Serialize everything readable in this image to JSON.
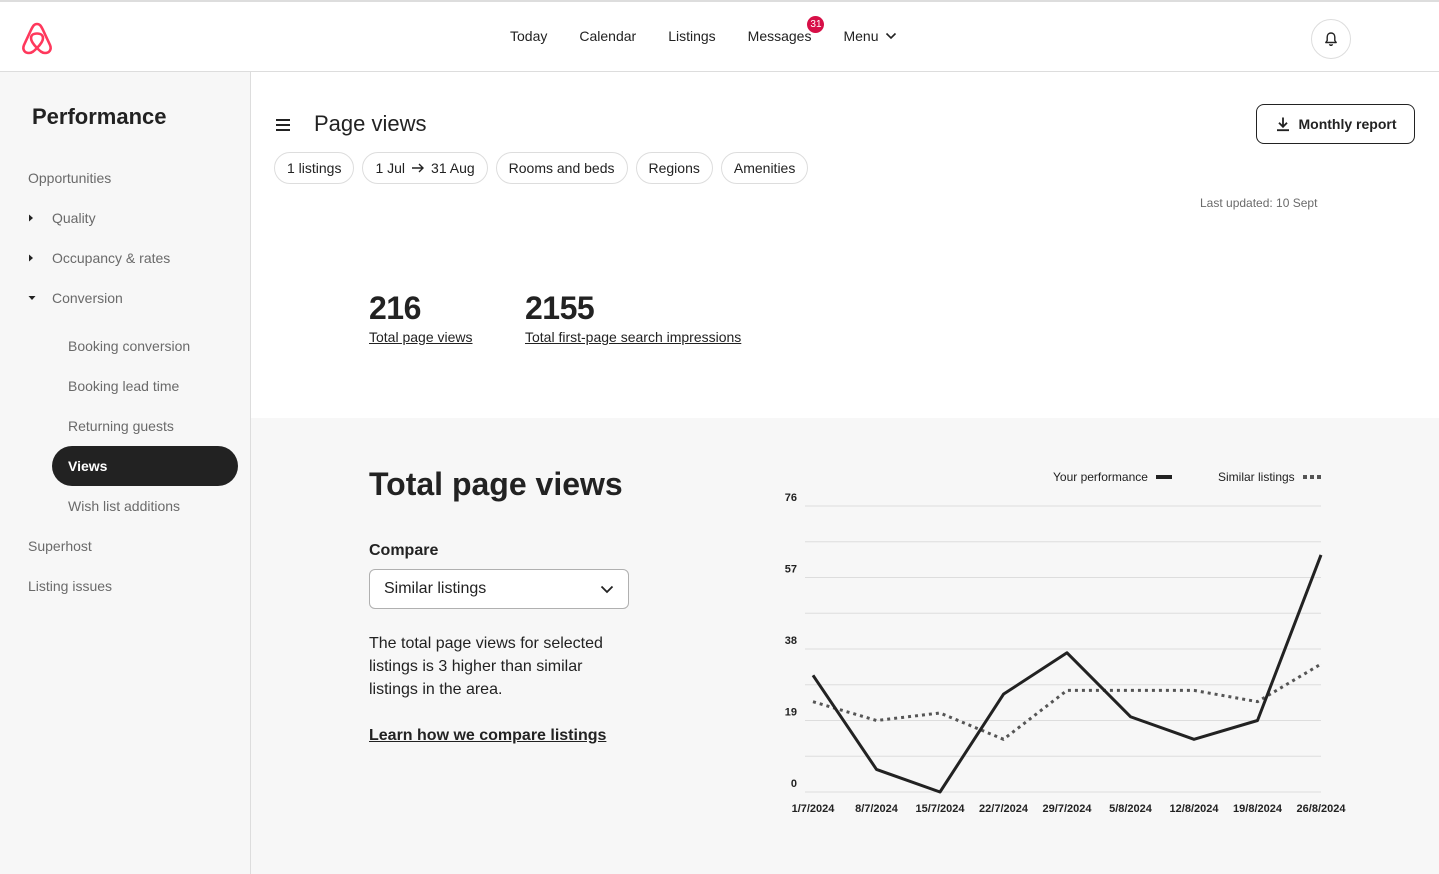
{
  "topnav": {
    "items": [
      "Today",
      "Calendar",
      "Listings",
      "Messages"
    ],
    "messages_badge": "31",
    "menu_label": "Menu"
  },
  "sidebar": {
    "title": "Performance",
    "items": [
      {
        "label": "Opportunities"
      },
      {
        "label": "Quality"
      },
      {
        "label": "Occupancy & rates"
      },
      {
        "label": "Conversion"
      },
      {
        "label": "Booking conversion"
      },
      {
        "label": "Booking lead time"
      },
      {
        "label": "Returning guests"
      },
      {
        "label": "Views"
      },
      {
        "label": "Wish list additions"
      },
      {
        "label": "Superhost"
      },
      {
        "label": "Listing issues"
      }
    ]
  },
  "header": {
    "title": "Page views",
    "monthly_report": "Monthly report",
    "filters": {
      "listings": "1 listings",
      "date_from": "1 Jul",
      "date_to": "31 Aug",
      "rooms": "Rooms and beds",
      "regions": "Regions",
      "amenities": "Amenities"
    },
    "last_updated": "Last updated: 10 Sept"
  },
  "stats": [
    {
      "value": "216",
      "label": "Total page views"
    },
    {
      "value": "2155",
      "label": "Total first-page search impressions"
    }
  ],
  "panel": {
    "title": "Total page views",
    "compare_label": "Compare",
    "compare_value": "Similar listings",
    "description": "The total page views for selected listings is 3 higher than similar listings in the area.",
    "learn_link": "Learn how we compare listings"
  },
  "colors": {
    "brand": "#ff385c",
    "badge": "#d70f47",
    "dark": "#222222",
    "muted": "#6a6a6a",
    "panel_bg": "#f7f7f7"
  },
  "chart_data": {
    "type": "line",
    "x": [
      "1/7/2024",
      "8/7/2024",
      "15/7/2024",
      "22/7/2024",
      "29/7/2024",
      "5/8/2024",
      "12/8/2024",
      "19/8/2024",
      "26/8/2024"
    ],
    "yticks": [
      0,
      19,
      38,
      57,
      76
    ],
    "ylim": [
      0,
      76
    ],
    "grid": true,
    "legend_position": "top-right",
    "series": [
      {
        "name": "Your performance",
        "style": "solid",
        "values": [
          31,
          6,
          0,
          26,
          37,
          20,
          14,
          19,
          63
        ]
      },
      {
        "name": "Similar listings",
        "style": "dotted",
        "values": [
          24,
          19,
          21,
          14,
          27,
          27,
          27,
          24,
          34
        ],
        "mid_values": [
          22,
          19,
          20,
          19,
          17,
          23,
          27,
          27,
          26,
          27,
          27,
          26,
          25,
          25,
          30
        ]
      }
    ]
  }
}
